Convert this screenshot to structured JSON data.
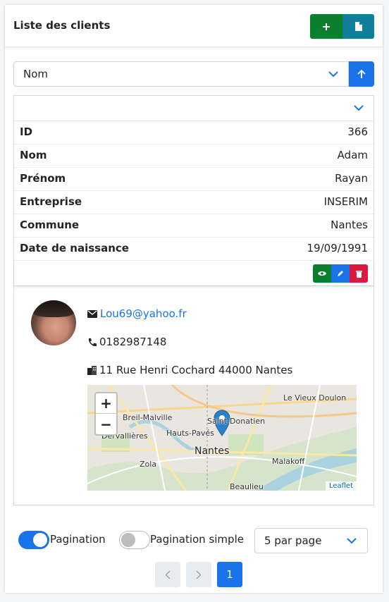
{
  "header": {
    "title": "Liste des clients",
    "add_icon": "plus-icon",
    "export_icon": "file-icon"
  },
  "sort": {
    "field": "Nom",
    "direction_icon": "arrow-up-icon"
  },
  "record": {
    "fields": [
      {
        "label": "ID",
        "value": "366"
      },
      {
        "label": "Nom",
        "value": "Adam"
      },
      {
        "label": "Prénom",
        "value": "Rayan"
      },
      {
        "label": "Entreprise",
        "value": "INSERIM"
      },
      {
        "label": "Commune",
        "value": "Nantes"
      },
      {
        "label": "Date de naissance",
        "value": "19/09/1991"
      }
    ],
    "actions": {
      "view_icon": "eye-icon",
      "edit_icon": "pencil-icon",
      "delete_icon": "trash-icon"
    }
  },
  "details": {
    "email": "Lou69@yahoo.fr",
    "phone": "0182987148",
    "address": "11 Rue Henri Cochard 44000 Nantes"
  },
  "map": {
    "zoom_in": "+",
    "zoom_out": "−",
    "attribution": "Leaflet",
    "labels": [
      "Le Vieux Doulon",
      "Breil-Malville",
      "Saint-Donatien",
      "Dervallières",
      "Hauts-Pavés",
      "Nantes",
      "Malakoff",
      "Zola",
      "Beaulieu"
    ]
  },
  "footer": {
    "pagination_label": "Pagination",
    "pagination_on": true,
    "simple_label": "Pagination simple",
    "simple_on": false,
    "per_page": "5 par page",
    "current_page": "1"
  },
  "colors": {
    "primary": "#1a73e8",
    "success": "#0c7f2e",
    "info": "#127f9a",
    "danger": "#dc1a3f"
  }
}
